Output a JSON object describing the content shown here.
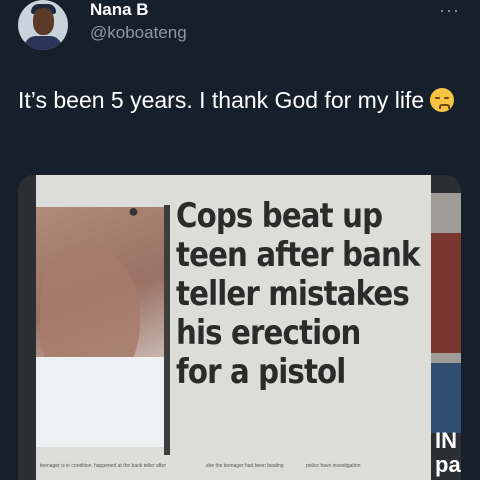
{
  "tweet": {
    "author_name": "Nana B",
    "author_handle": "@koboateng",
    "more_icon": "more-horizontal-icon",
    "text": "It’s been 5 years. I thank God for my life",
    "emoji_name": "pensive-face-emoji"
  },
  "media": {
    "headline_lines": [
      "Cops beat up",
      "teen after bank",
      "teller mistakes",
      "his erection",
      "for a pistol"
    ],
    "side_ad_text": "IN\npa",
    "fine_print": [
      "teenager is in\ncondition",
      "happened at the bank teller\nafter",
      "she the teenager had been\nbeating",
      "police have\ninvestigation"
    ]
  }
}
